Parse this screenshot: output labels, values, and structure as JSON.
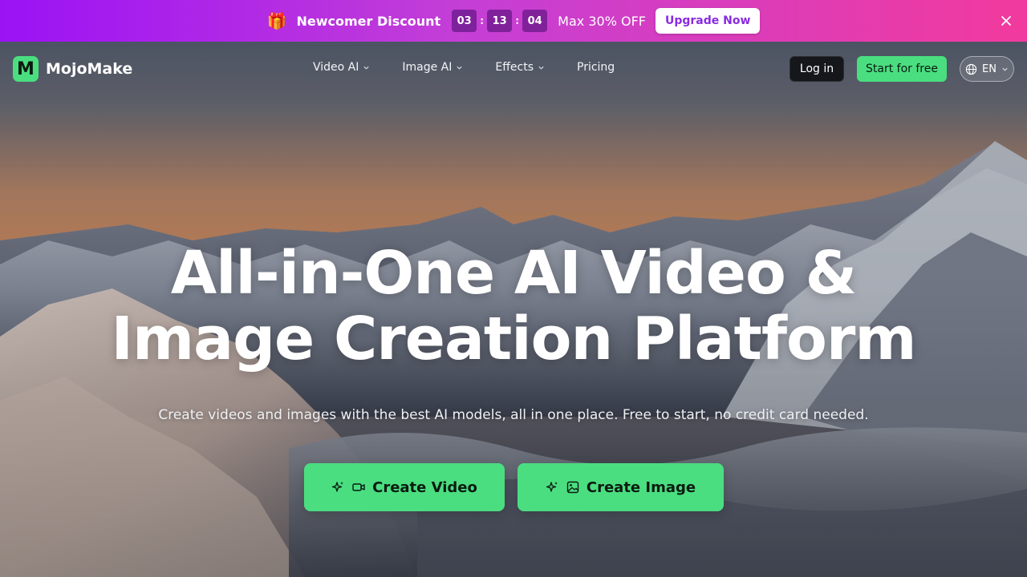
{
  "promo": {
    "gift_icon": "gift-icon",
    "title": "Newcomer Discount",
    "countdown": [
      "03",
      "13",
      "04"
    ],
    "separator": ":",
    "offer": "Max 30% OFF",
    "upgrade_label": "Upgrade Now",
    "close_icon": "close-icon",
    "gradient": [
      "#9b12f5",
      "#f23a9d"
    ]
  },
  "nav": {
    "logo_mark": "M",
    "brand": "MojoMake",
    "items": [
      {
        "label": "Video AI",
        "has_dropdown": true
      },
      {
        "label": "Image AI",
        "has_dropdown": true
      },
      {
        "label": "Effects",
        "has_dropdown": true
      },
      {
        "label": "Pricing",
        "has_dropdown": false
      }
    ],
    "login_label": "Log in",
    "start_label": "Start for free",
    "language": "EN"
  },
  "hero": {
    "title_line1": "All-in-One AI Video &",
    "title_line2": "Image Creation Platform",
    "subtitle": "Create videos and images with the best AI models, all in one place. Free to start, no credit card needed.",
    "cta_video": "Create Video",
    "cta_image": "Create Image"
  },
  "colors": {
    "accent": "#4ade80",
    "login_bg": "#15171b",
    "upgrade_text": "#8a2be2"
  }
}
